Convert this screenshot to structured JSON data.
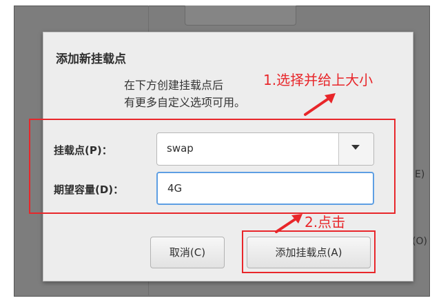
{
  "background": {
    "label_e": "E)",
    "label_o": "(O)"
  },
  "dialog": {
    "title": "添加新挂载点",
    "desc_line1": "在下方创建挂载点后",
    "desc_line2": "有更多自定义选项可用。",
    "mount_point_label": "挂载点(P)：",
    "mount_point_value": "swap",
    "capacity_label": "期望容量(D)：",
    "capacity_value": "4G",
    "cancel_label": "取消(C)",
    "add_label": "添加挂载点(A)"
  },
  "annotations": {
    "step1": "1.选择并给上大小",
    "step2": "2.点击",
    "color": "#e8262a"
  },
  "colors": {
    "dialog_bg": "#ededed",
    "backdrop": "#7d7d7d",
    "focus_border": "#5d9ee3"
  }
}
